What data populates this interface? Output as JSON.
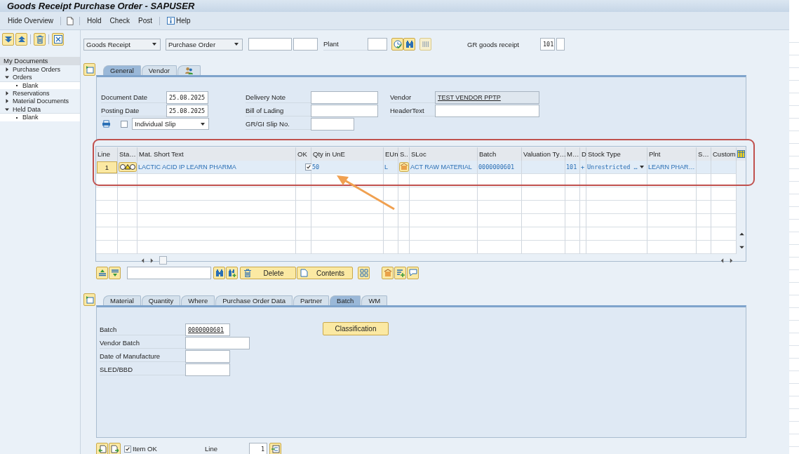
{
  "window": {
    "title": "Goods Receipt Purchase Order - SAPUSER"
  },
  "toolbar": {
    "hide_overview": "Hide Overview",
    "actions": [
      "Hold",
      "Check",
      "Post"
    ],
    "help": "Help"
  },
  "sidebar": {
    "header": "My Documents",
    "items": [
      {
        "label": "Purchase Orders",
        "expanded": false
      },
      {
        "label": "Orders",
        "expanded": true,
        "children": [
          {
            "label": "Blank"
          }
        ]
      },
      {
        "label": "Reservations",
        "expanded": false
      },
      {
        "label": "Material Documents",
        "expanded": false
      },
      {
        "label": "Held Data",
        "expanded": true,
        "children": [
          {
            "label": "Blank"
          }
        ]
      }
    ]
  },
  "selection": {
    "transaction": "Goods Receipt",
    "reference": "Purchase Order",
    "plant_label": "Plant",
    "movement_label": "GR goods receipt",
    "movement_type": "101"
  },
  "header_tabs": [
    {
      "kind": "text",
      "label": "General",
      "selected": true
    },
    {
      "kind": "text",
      "label": "Vendor",
      "selected": false
    },
    {
      "kind": "icon",
      "selected": false
    }
  ],
  "header": {
    "document_date_label": "Document Date",
    "document_date": "25.08.2025",
    "posting_date_label": "Posting Date",
    "posting_date": "25.08.2025",
    "print_checked": false,
    "slip_type": "Individual Slip",
    "delivery_note_label": "Delivery Note",
    "bill_of_lading_label": "Bill of Lading",
    "slip_no_label": "GR/GI Slip No.",
    "vendor_label": "Vendor",
    "vendor": "TEST VENDOR PPTP",
    "header_text_label": "HeaderText"
  },
  "table": {
    "columns": [
      "Line",
      "Sta…",
      "Mat. Short Text",
      "OK",
      "Qty in UnE",
      "EUn",
      "S..",
      "SLoc",
      "Batch",
      "Valuation Ty…",
      "M…",
      "D",
      "Stock Type",
      "Plnt",
      "S…",
      "Custom"
    ],
    "rows": [
      {
        "line": "1",
        "warning": true,
        "material": "LACTIC ACID IP LEARN PHARMA",
        "ok": true,
        "qty": "50",
        "unit": "L",
        "sloc": "ACT RAW MATERIAL",
        "batch": "0000000601",
        "movement": "101",
        "debit_credit": "+",
        "stock_type": "Unrestricted …",
        "plant": "LEARN PHAR…"
      }
    ]
  },
  "table_toolbar": {
    "delete": "Delete",
    "contents": "Contents"
  },
  "item_tabs": [
    {
      "label": "Material",
      "selected": false
    },
    {
      "label": "Quantity",
      "selected": false
    },
    {
      "label": "Where",
      "selected": false
    },
    {
      "label": "Purchase Order Data",
      "selected": false
    },
    {
      "label": "Partner",
      "selected": false
    },
    {
      "label": "Batch",
      "selected": true
    },
    {
      "label": "WM",
      "selected": false
    }
  ],
  "batch_detail": {
    "fields": [
      {
        "label": "Batch",
        "value": "0000000601"
      },
      {
        "label": "Vendor Batch"
      },
      {
        "label": "Date of Manufacture"
      },
      {
        "label": "SLED/BBD"
      }
    ],
    "classification": "Classification"
  },
  "footer": {
    "item_ok_label": "Item OK",
    "item_ok": true,
    "line_label": "Line",
    "line": "1"
  }
}
